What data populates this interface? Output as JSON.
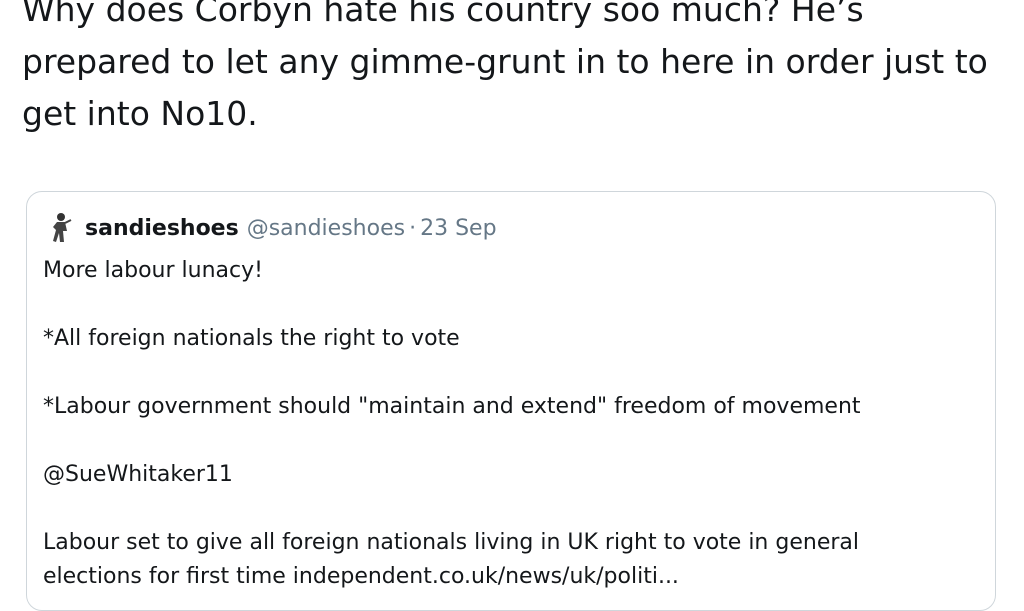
{
  "tweet": {
    "text": "Why does Corbyn hate his country soo much? He’s prepared to let any gimme-grunt in to here in order just to get into No10."
  },
  "quoted_tweet": {
    "avatar_icon": "person-figure-icon",
    "display_name": "sandieshoes",
    "handle": "@sandieshoes",
    "separator": "·",
    "date": "23 Sep",
    "lines": [
      "More labour lunacy!",
      "*All foreign nationals the right to vote",
      "*Labour government should \"maintain and extend\" freedom of movement",
      "@SueWhitaker11"
    ],
    "final_line": "Labour set to give all foreign nationals living in UK right to vote in general",
    "link_line": "elections for first time independent.co.uk/news/uk/politi..."
  },
  "colors": {
    "text": "#14171a",
    "muted": "#657786",
    "border": "#cfd6db"
  }
}
